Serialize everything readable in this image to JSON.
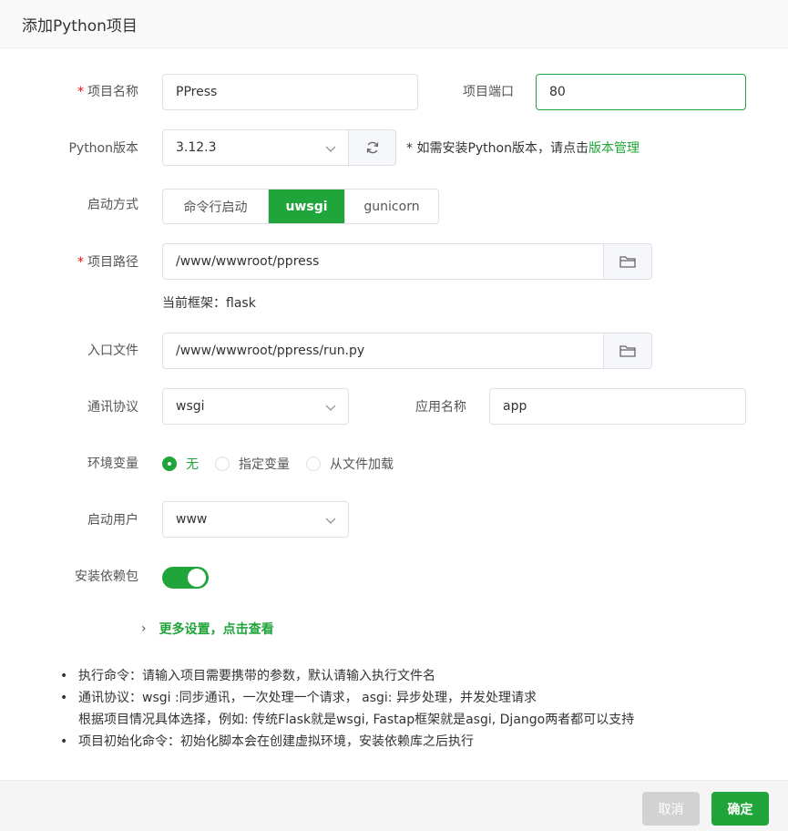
{
  "dialog": {
    "title": "添加Python项目"
  },
  "form": {
    "project_name": {
      "label": "项目名称",
      "required": "*",
      "value": "PPress"
    },
    "project_port": {
      "label": "项目端口",
      "value": "80"
    },
    "python_version": {
      "label": "Python版本",
      "value": "3.12.3",
      "hint_prefix": "* 如需安装Python版本，请点击",
      "hint_link": "版本管理"
    },
    "start_mode": {
      "label": "启动方式",
      "options": [
        "命令行启动",
        "uwsgi",
        "gunicorn"
      ],
      "selected": "uwsgi"
    },
    "project_path": {
      "label": "项目路径",
      "required": "*",
      "value": "/www/wwwroot/ppress"
    },
    "framework": {
      "text": "当前框架：flask"
    },
    "entry_file": {
      "label": "入口文件",
      "value": "/www/wwwroot/ppress/run.py"
    },
    "protocol": {
      "label": "通讯协议",
      "value": "wsgi"
    },
    "app_name": {
      "label": "应用名称",
      "value": "app"
    },
    "env_vars": {
      "label": "环境变量",
      "options": [
        "无",
        "指定变量",
        "从文件加载"
      ],
      "selected": "无"
    },
    "run_user": {
      "label": "启动用户",
      "value": "www"
    },
    "install_deps": {
      "label": "安装依赖包",
      "enabled": true
    }
  },
  "more_settings": {
    "chevron": "›",
    "label": "更多设置，点击查看"
  },
  "notes": [
    "执行命令：请输入项目需要携带的参数，默认请输入执行文件名",
    "通讯协议：wsgi :同步通讯，一次处理一个请求， asgi: 异步处理，并发处理请求",
    "根据项目情况具体选择，例如: 传统Flask就是wsgi, Fastap框架就是asgi, Django两者都可以支持",
    "项目初始化命令：初始化脚本会在创建虚拟环境，安装依赖库之后执行"
  ],
  "footer": {
    "cancel_label": "取消",
    "ok_label": "确定"
  },
  "colors": {
    "accent": "#20a53a",
    "required": "#ef0808"
  }
}
